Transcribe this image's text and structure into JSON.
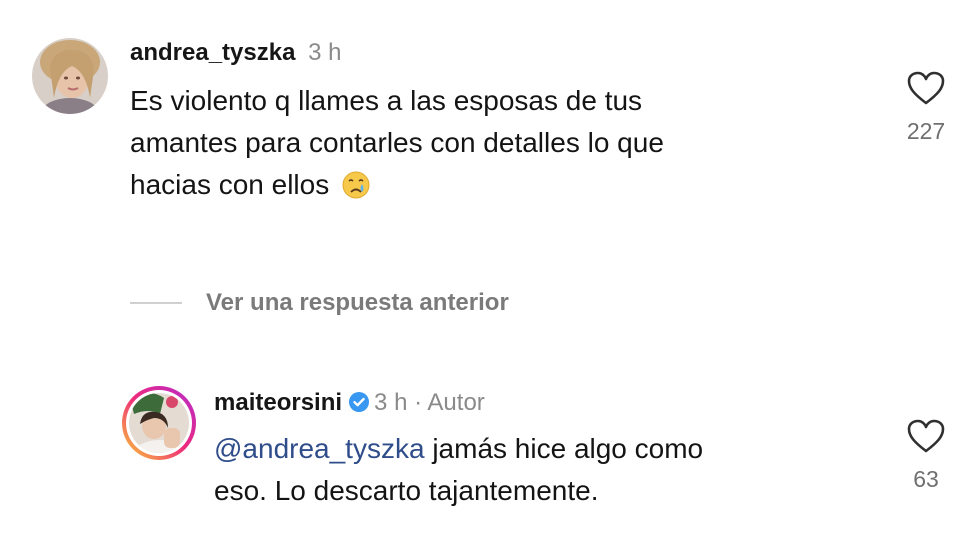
{
  "comments": [
    {
      "username": "andrea_tyszka",
      "time": "3 h",
      "text_lines": [
        "Es violento q llames a las esposas de tus",
        "amantes para contarles con detalles lo que",
        "hacias con ellos"
      ],
      "emoji": "crying-face",
      "likes": "227"
    }
  ],
  "replies_toggle": {
    "label": "Ver una respuesta anterior"
  },
  "reply": {
    "username": "maiteorsini",
    "verified": true,
    "meta": "3 h · Autor",
    "mention": "@andrea_tyszka",
    "text_line1_rest": " jamás hice algo como",
    "text_line2": "eso. Lo descarto tajantemente.",
    "likes": "63"
  },
  "colors": {
    "mention": "#2f4d8a",
    "verified": "#3897f0",
    "story_ring_start": "#f9ce34",
    "story_ring_end": "#ee2a7b"
  }
}
